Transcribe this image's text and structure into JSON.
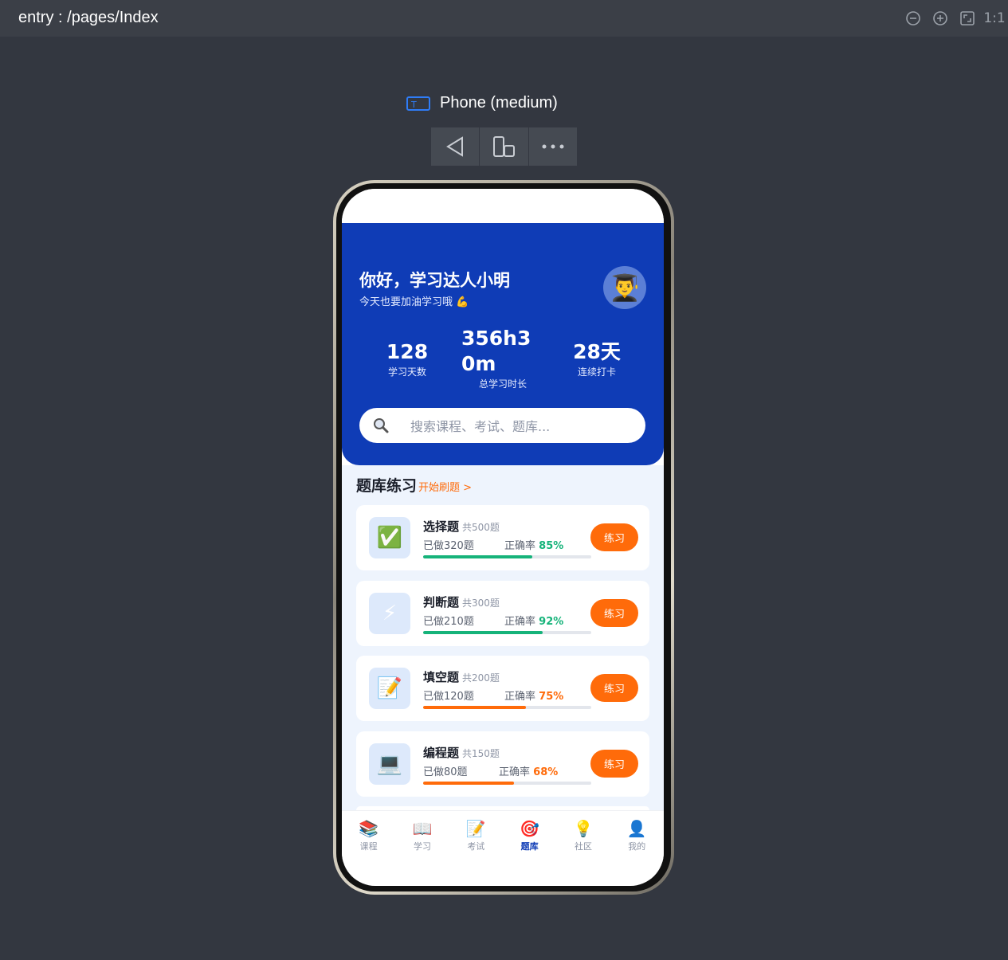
{
  "window": {
    "title": "entry : /pages/Index"
  },
  "toolbar": {
    "zoom_out": "zoom-out-icon",
    "zoom_in": "zoom-in-icon",
    "fit": "fit-icon",
    "actual_size": "1:1"
  },
  "device": {
    "name": "Phone (medium)"
  },
  "app": {
    "greeting": "你好，学习达人小明",
    "subtitle": "今天也要加油学习哦 💪",
    "avatar": "👨‍🎓",
    "stats": [
      {
        "value": "128",
        "label": "学习天数"
      },
      {
        "value": "356h30m",
        "label": "总学习时长"
      },
      {
        "value": "28天",
        "label": "连续打卡"
      }
    ],
    "search_placeholder": "搜索课程、考试、题库...",
    "section": {
      "title": "题库练习",
      "link": "开始刷题 >"
    },
    "cards": [
      {
        "icon": "✅",
        "name": "选择题",
        "total": "共500题",
        "done": "已做320题",
        "acc_label": "正确率",
        "acc": "85%",
        "progress": 0.65,
        "color": "#16b37a",
        "button": "练习"
      },
      {
        "icon": "⚡",
        "name": "判断题",
        "total": "共300题",
        "done": "已做210题",
        "acc_label": "正确率",
        "acc": "92%",
        "progress": 0.71,
        "color": "#16b37a",
        "button": "练习"
      },
      {
        "icon": "📝",
        "name": "填空题",
        "total": "共200题",
        "done": "已做120题",
        "acc_label": "正确率",
        "acc": "75%",
        "progress": 0.61,
        "color": "#ff6b0a",
        "button": "练习"
      },
      {
        "icon": "💻",
        "name": "编程题",
        "total": "共150题",
        "done": "已做80题",
        "acc_label": "正确率",
        "acc": "68%",
        "progress": 0.54,
        "color": "#ff6b0a",
        "button": "练习"
      }
    ],
    "tabs": [
      {
        "icon": "📚",
        "label": "课程"
      },
      {
        "icon": "📖",
        "label": "学习"
      },
      {
        "icon": "📝",
        "label": "考试"
      },
      {
        "icon": "🎯",
        "label": "题库"
      },
      {
        "icon": "💡",
        "label": "社区"
      },
      {
        "icon": "👤",
        "label": "我的"
      }
    ],
    "active_tab": "题库"
  }
}
